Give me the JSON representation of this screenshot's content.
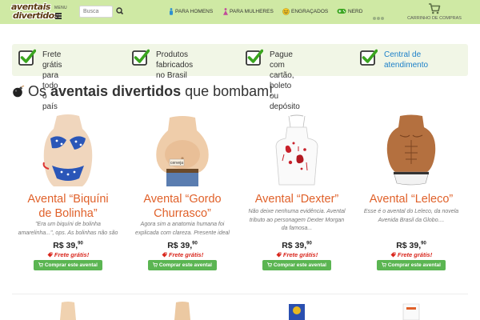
{
  "header": {
    "logo": {
      "line1": "aventais",
      "line2": "divertidos"
    },
    "menu_label": "Menu",
    "search": {
      "placeholder": "Busca",
      "value": ""
    },
    "nav": [
      {
        "label": "Para Homens",
        "icon": "male-icon"
      },
      {
        "label": "Para Mulheres",
        "icon": "female-icon"
      },
      {
        "label": "Engraçados",
        "icon": "smiley-icon"
      },
      {
        "label": "Nerd",
        "icon": "gamepad-icon"
      }
    ],
    "cart_label": "Carrinho de compras"
  },
  "benefits": [
    {
      "line1": "Frete grátis para",
      "line2": "todo o país",
      "link": false
    },
    {
      "line1": "Produtos fabricados",
      "line2": "no Brasil",
      "link": false
    },
    {
      "line1": "Pague com cartão,",
      "line2": "boleto ou depósito",
      "link": false
    },
    {
      "line1": "Central de",
      "line2": "atendimento",
      "link": true
    }
  ],
  "headline": {
    "prefix": "Os ",
    "bold": "aventais divertidos",
    "suffix": " que bombam!"
  },
  "products": [
    {
      "name_line1": "Avental “Biquíni",
      "name_line2": "de Bolinha”",
      "description": "\"Era um biquíni de bolinha amarelinha...\", ops. As bolinhas não são amarelas...",
      "price_main": "R$ 39,",
      "price_cents": "90",
      "shipping": "Frete grátis!",
      "button": "Comprar este avental"
    },
    {
      "name_line1": "Avental “Gordo",
      "name_line2": "Churrasco”",
      "description": "Agora sim a anatomia humana foi explicada com clareza. Presente ideal para...",
      "price_main": "R$ 39,",
      "price_cents": "90",
      "shipping": "Frete grátis!",
      "button": "Comprar este avental",
      "label_on_image": "cerveja"
    },
    {
      "name_line1": "Avental “Dexter”",
      "name_line2": "",
      "description": "Não deixe nenhuma evidência. Avental tributo ao personagem Dexter Morgan da famosa...",
      "price_main": "R$ 39,",
      "price_cents": "90",
      "shipping": "Frete grátis!",
      "button": "Comprar este avental"
    },
    {
      "name_line1": "Avental “Leleco”",
      "name_line2": "",
      "description": "Esse é o avental do Leleco, da novela Avenida Brasil da Globo....",
      "price_main": "R$ 39,",
      "price_cents": "90",
      "shipping": "Frete grátis!",
      "button": "Comprar este avental"
    }
  ],
  "colors": {
    "header_bg": "#cfe9a4",
    "accent_orange": "#e0612a",
    "check_green": "#3aa51f",
    "button_green": "#5bb552",
    "link_blue": "#1d80c9",
    "shipping_red": "#d9261c"
  }
}
